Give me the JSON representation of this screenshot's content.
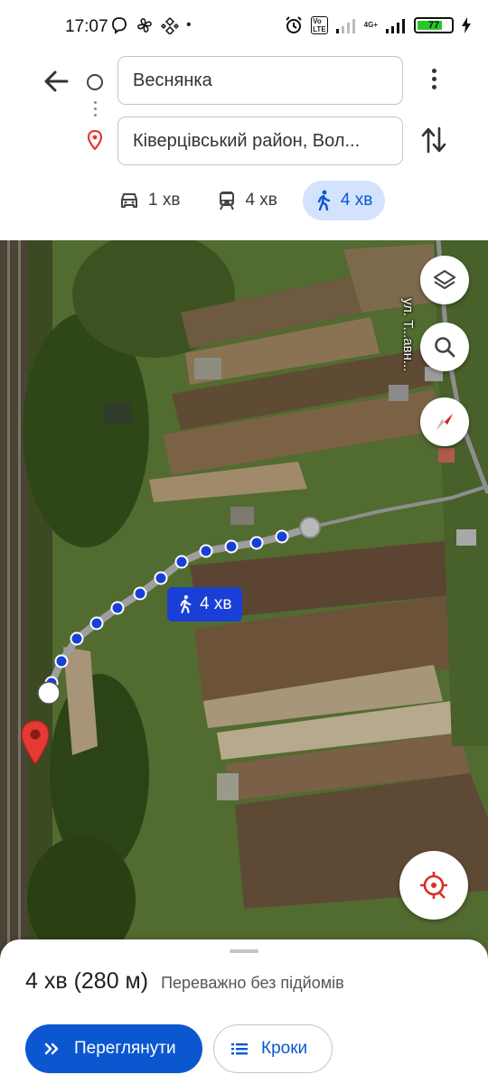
{
  "status_bar": {
    "time": "17:07",
    "network": "4G+",
    "volte": "Vo LTE",
    "battery": "77",
    "battery_level_percent": 77
  },
  "directions": {
    "origin": "Веснянка",
    "destination": "Ківерцівський район, Вол...",
    "modes": [
      {
        "name": "car",
        "label": "1 хв",
        "active": false
      },
      {
        "name": "transit",
        "label": "4 хв",
        "active": false
      },
      {
        "name": "walk",
        "label": "4 хв",
        "active": true
      }
    ]
  },
  "map": {
    "route_duration_label": "4 хв",
    "street_label": "ул. Т...авн..."
  },
  "route_sheet": {
    "summary": "4 хв (280 м)",
    "note": "Переважно без підйомів",
    "preview_button": "Переглянути",
    "steps_button": "Кроки"
  },
  "colors": {
    "accent": "#0b57d0",
    "active_mode_bg": "#d3e3fd",
    "route_dots": "#1a3fd6",
    "destination_pin": "#e53935"
  }
}
